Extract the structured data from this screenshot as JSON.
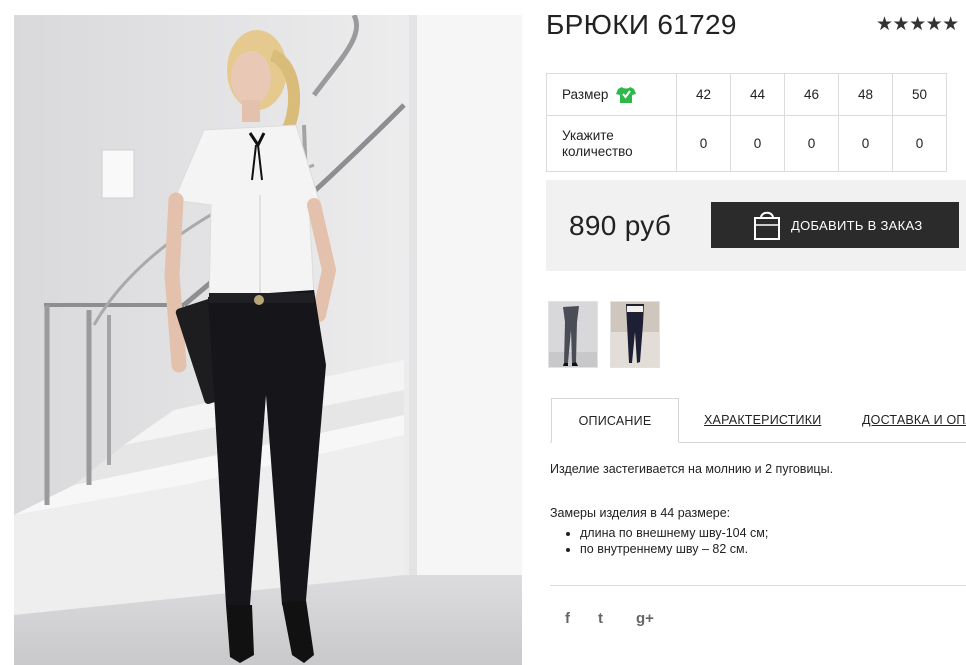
{
  "product": {
    "title": "БРЮКИ 61729",
    "rating_stars": "★★★★★"
  },
  "sizes": {
    "size_label": "Размер",
    "qty_label": "Укажите количество",
    "size_icon": "t-shirt-icon",
    "values": [
      "42",
      "44",
      "46",
      "48",
      "50"
    ],
    "quantities": [
      "0",
      "0",
      "0",
      "0",
      "0"
    ]
  },
  "buy": {
    "price": "890 руб",
    "add_button_label": "ДОБАВИТЬ В ЗАКАЗ",
    "bag_icon": "shopping-bag-icon"
  },
  "tabs": [
    {
      "label": "ОПИСАНИЕ",
      "active": true
    },
    {
      "label": "ХАРАКТЕРИСТИКИ",
      "active": false
    },
    {
      "label": "ДОСТАВКА И ОПЛ",
      "active": false
    }
  ],
  "description": {
    "text": "Изделие застегивается на молнию и 2 пуговицы.",
    "measure_title": "Замеры изделия в 44 размере:",
    "measures": [
      "длина по внешнему шву-104 см;",
      "по внутреннему шву – 82 см."
    ]
  },
  "social": {
    "facebook": "f",
    "twitter": "t",
    "google_plus": "g+"
  },
  "colors": {
    "button_bg": "#2b2b2b",
    "buybox_bg": "#f1f1f1",
    "size_icon": "#2db84a"
  }
}
